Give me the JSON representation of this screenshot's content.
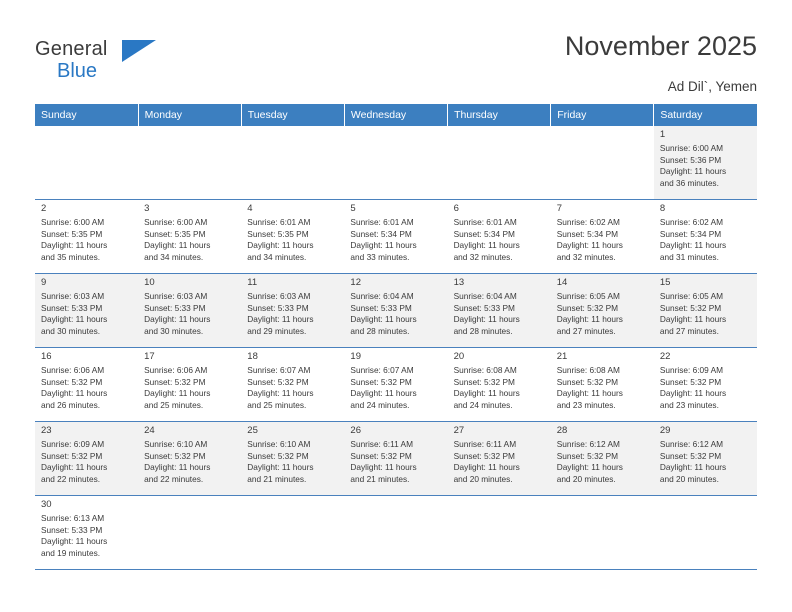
{
  "brand": {
    "line1": "General",
    "line2": "Blue",
    "flag_icon": "triangle-flag-icon"
  },
  "header": {
    "title": "November 2025",
    "location": "Ad Dil`, Yemen"
  },
  "calendar": {
    "weekday_headers": [
      "Sunday",
      "Monday",
      "Tuesday",
      "Wednesday",
      "Thursday",
      "Friday",
      "Saturday"
    ],
    "accent_color": "#3c7fc0",
    "row_shade_color": "#f2f2f2",
    "weeks": [
      [
        {
          "day": "",
          "text": ""
        },
        {
          "day": "",
          "text": ""
        },
        {
          "day": "",
          "text": ""
        },
        {
          "day": "",
          "text": ""
        },
        {
          "day": "",
          "text": ""
        },
        {
          "day": "",
          "text": ""
        },
        {
          "day": "1",
          "text": "Sunrise: 6:00 AM\nSunset: 5:36 PM\nDaylight: 11 hours\nand 36 minutes."
        }
      ],
      [
        {
          "day": "2",
          "text": "Sunrise: 6:00 AM\nSunset: 5:35 PM\nDaylight: 11 hours\nand 35 minutes."
        },
        {
          "day": "3",
          "text": "Sunrise: 6:00 AM\nSunset: 5:35 PM\nDaylight: 11 hours\nand 34 minutes."
        },
        {
          "day": "4",
          "text": "Sunrise: 6:01 AM\nSunset: 5:35 PM\nDaylight: 11 hours\nand 34 minutes."
        },
        {
          "day": "5",
          "text": "Sunrise: 6:01 AM\nSunset: 5:34 PM\nDaylight: 11 hours\nand 33 minutes."
        },
        {
          "day": "6",
          "text": "Sunrise: 6:01 AM\nSunset: 5:34 PM\nDaylight: 11 hours\nand 32 minutes."
        },
        {
          "day": "7",
          "text": "Sunrise: 6:02 AM\nSunset: 5:34 PM\nDaylight: 11 hours\nand 32 minutes."
        },
        {
          "day": "8",
          "text": "Sunrise: 6:02 AM\nSunset: 5:34 PM\nDaylight: 11 hours\nand 31 minutes."
        }
      ],
      [
        {
          "day": "9",
          "text": "Sunrise: 6:03 AM\nSunset: 5:33 PM\nDaylight: 11 hours\nand 30 minutes."
        },
        {
          "day": "10",
          "text": "Sunrise: 6:03 AM\nSunset: 5:33 PM\nDaylight: 11 hours\nand 30 minutes."
        },
        {
          "day": "11",
          "text": "Sunrise: 6:03 AM\nSunset: 5:33 PM\nDaylight: 11 hours\nand 29 minutes."
        },
        {
          "day": "12",
          "text": "Sunrise: 6:04 AM\nSunset: 5:33 PM\nDaylight: 11 hours\nand 28 minutes."
        },
        {
          "day": "13",
          "text": "Sunrise: 6:04 AM\nSunset: 5:33 PM\nDaylight: 11 hours\nand 28 minutes."
        },
        {
          "day": "14",
          "text": "Sunrise: 6:05 AM\nSunset: 5:32 PM\nDaylight: 11 hours\nand 27 minutes."
        },
        {
          "day": "15",
          "text": "Sunrise: 6:05 AM\nSunset: 5:32 PM\nDaylight: 11 hours\nand 27 minutes."
        }
      ],
      [
        {
          "day": "16",
          "text": "Sunrise: 6:06 AM\nSunset: 5:32 PM\nDaylight: 11 hours\nand 26 minutes."
        },
        {
          "day": "17",
          "text": "Sunrise: 6:06 AM\nSunset: 5:32 PM\nDaylight: 11 hours\nand 25 minutes."
        },
        {
          "day": "18",
          "text": "Sunrise: 6:07 AM\nSunset: 5:32 PM\nDaylight: 11 hours\nand 25 minutes."
        },
        {
          "day": "19",
          "text": "Sunrise: 6:07 AM\nSunset: 5:32 PM\nDaylight: 11 hours\nand 24 minutes."
        },
        {
          "day": "20",
          "text": "Sunrise: 6:08 AM\nSunset: 5:32 PM\nDaylight: 11 hours\nand 24 minutes."
        },
        {
          "day": "21",
          "text": "Sunrise: 6:08 AM\nSunset: 5:32 PM\nDaylight: 11 hours\nand 23 minutes."
        },
        {
          "day": "22",
          "text": "Sunrise: 6:09 AM\nSunset: 5:32 PM\nDaylight: 11 hours\nand 23 minutes."
        }
      ],
      [
        {
          "day": "23",
          "text": "Sunrise: 6:09 AM\nSunset: 5:32 PM\nDaylight: 11 hours\nand 22 minutes."
        },
        {
          "day": "24",
          "text": "Sunrise: 6:10 AM\nSunset: 5:32 PM\nDaylight: 11 hours\nand 22 minutes."
        },
        {
          "day": "25",
          "text": "Sunrise: 6:10 AM\nSunset: 5:32 PM\nDaylight: 11 hours\nand 21 minutes."
        },
        {
          "day": "26",
          "text": "Sunrise: 6:11 AM\nSunset: 5:32 PM\nDaylight: 11 hours\nand 21 minutes."
        },
        {
          "day": "27",
          "text": "Sunrise: 6:11 AM\nSunset: 5:32 PM\nDaylight: 11 hours\nand 20 minutes."
        },
        {
          "day": "28",
          "text": "Sunrise: 6:12 AM\nSunset: 5:32 PM\nDaylight: 11 hours\nand 20 minutes."
        },
        {
          "day": "29",
          "text": "Sunrise: 6:12 AM\nSunset: 5:32 PM\nDaylight: 11 hours\nand 20 minutes."
        }
      ],
      [
        {
          "day": "30",
          "text": "Sunrise: 6:13 AM\nSunset: 5:33 PM\nDaylight: 11 hours\nand 19 minutes."
        },
        {
          "day": "",
          "text": ""
        },
        {
          "day": "",
          "text": ""
        },
        {
          "day": "",
          "text": ""
        },
        {
          "day": "",
          "text": ""
        },
        {
          "day": "",
          "text": ""
        },
        {
          "day": "",
          "text": ""
        }
      ]
    ]
  }
}
